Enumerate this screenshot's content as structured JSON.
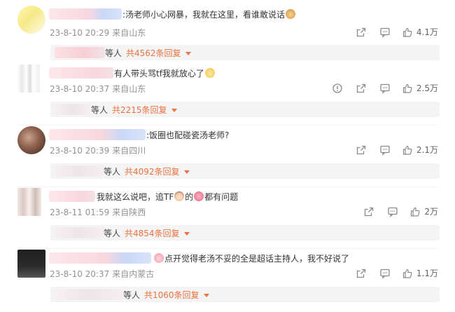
{
  "comments": [
    {
      "text": ":汤老师小心网暴，我就在这里，看谁敢说话",
      "emoji": "cat-face-emoji",
      "time": "23-8-10 20:29",
      "location": "来自山东",
      "likes": "4.1万",
      "reply_people": "等人",
      "reply_count": "共4562条回复",
      "has_report": false
    },
    {
      "text": "有人带头骂tf我就放心了",
      "emoji": "cat-face-emoji",
      "time": "23-8-10 20:37",
      "location": "来自山东",
      "likes": "2.5万",
      "reply_people": "等人",
      "reply_count": "共2215条回复",
      "has_report": true
    },
    {
      "text": ":饭圈也配碰瓷汤老师?",
      "time": "23-8-10 20:39",
      "location": "来自四川",
      "likes": "2.1万",
      "reply_people": "等人",
      "reply_count": "共4092条回复",
      "has_report": false
    },
    {
      "text_a": "我就这么说吧，追TF",
      "text_b": "的",
      "text_c": "都有问题",
      "emoji_a": "face-emoji",
      "emoji_b": "brain-emoji",
      "time": "23-8-11 01:59",
      "location": "来自陕西",
      "likes": "2万",
      "reply_people": "等人",
      "reply_count": "共4854条回复",
      "has_report": false
    },
    {
      "text": "点开觉得老汤不妥的全是超话主持人，我不好说了",
      "emoji": "pig-face-emoji",
      "time": "23-8-10 20:37",
      "location": "来自内蒙古",
      "likes": "1.1万",
      "reply_people": "等人",
      "reply_count": "共1060条回复",
      "has_report": false
    }
  ],
  "colors": {
    "accent": "#eb7340",
    "meta": "#939393",
    "reply_bg": "#f4f4f4"
  },
  "icons": {
    "share": "share-icon",
    "comment": "comment-icon",
    "like": "thumbs-up-icon",
    "report": "report-icon",
    "expand": "caret-down-icon"
  }
}
